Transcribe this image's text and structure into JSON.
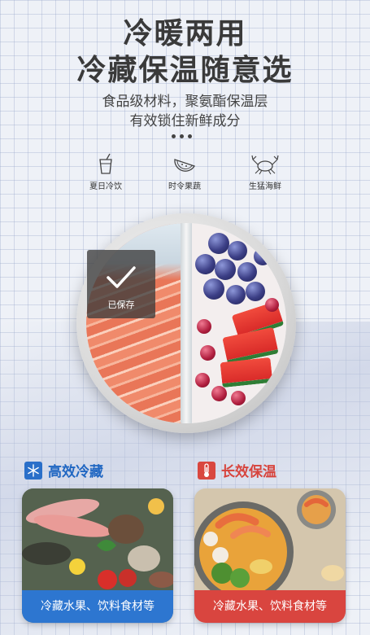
{
  "headline": {
    "line1": "冷暖两用",
    "line2": "冷藏保温随意选"
  },
  "subtitle": {
    "line1": "食品级材料，聚氨酯保温层",
    "line2": "有效锁住新鲜成分"
  },
  "features": [
    {
      "icon": "cold-drink-icon",
      "label": "夏日冷饮"
    },
    {
      "icon": "watermelon-icon",
      "label": "时令果蔬"
    },
    {
      "icon": "crab-icon",
      "label": "生猛海鲜"
    }
  ],
  "toast": {
    "label": "已保存",
    "icon": "checkmark-icon"
  },
  "sections": {
    "cold": {
      "title": "高效冷藏",
      "icon": "snowflake-icon",
      "caption": "冷藏水果、饮料食材等",
      "color": "#2d76d0"
    },
    "warm": {
      "title": "长效保温",
      "icon": "thermometer-icon",
      "caption": "冷藏水果、饮料食材等",
      "color": "#d9453f"
    }
  }
}
